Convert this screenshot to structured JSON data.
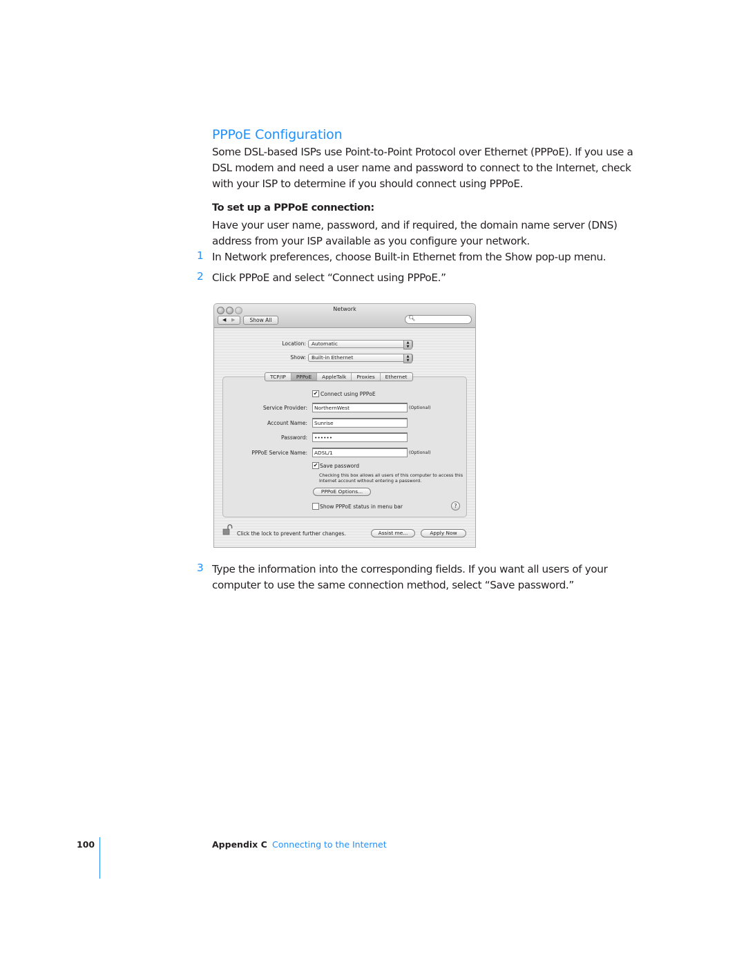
{
  "heading": "PPPoE Configuration",
  "intro": "Some DSL-based ISPs use Point-to-Point Protocol over Ethernet (PPPoE). If you use a DSL modem and need a user name and password to connect to the Internet, check with your ISP to determine if you should connect using PPPoE.",
  "subheading": "To set up a PPPoE connection:",
  "prereq": "Have your user name, password, and if required, the domain name server (DNS) address from your ISP available as you configure your network.",
  "steps": [
    {
      "num": "1",
      "text": "In Network preferences, choose Built-in Ethernet from the Show pop-up menu."
    },
    {
      "num": "2",
      "text": "Click PPPoE and select “Connect using PPPoE.”"
    },
    {
      "num": "3",
      "text": "Type the information into the corresponding fields. If you want all users of your computer to use the same connection method, select “Save password.”"
    }
  ],
  "window": {
    "title": "Network",
    "back_glyph": "◀",
    "forward_glyph": "▶",
    "show_all": "Show All",
    "search_glyph": "⚲",
    "location_label": "Location:",
    "location_value": "Automatic",
    "show_label": "Show:",
    "show_value": "Built-in Ethernet",
    "popup_arrows": "▲▼",
    "tabs": [
      {
        "label": "TCP/IP",
        "selected": false
      },
      {
        "label": "PPPoE",
        "selected": true
      },
      {
        "label": "AppleTalk",
        "selected": false
      },
      {
        "label": "Proxies",
        "selected": false
      },
      {
        "label": "Ethernet",
        "selected": false
      }
    ],
    "connect_checkbox": {
      "label": "Connect using PPPoE",
      "checked": true,
      "mark": "✔"
    },
    "fields": [
      {
        "label": "Service Provider:",
        "value": "NorthernWest",
        "optional": "(Optional)"
      },
      {
        "label": "Account Name:",
        "value": "Sunrise",
        "optional": ""
      },
      {
        "label": "Password:",
        "value": "••••••",
        "optional": ""
      },
      {
        "label": "PPPoE Service Name:",
        "value": "ADSL/1",
        "optional": "(Optional)"
      }
    ],
    "save_password": {
      "label": "Save password",
      "checked": true,
      "mark": "✔"
    },
    "save_note": "Checking this box allows all users of this computer to access this Internet account without entering a password.",
    "pppoe_options": "PPPoE Options...",
    "show_status": {
      "label": "Show PPPoE status in menu bar",
      "checked": false
    },
    "help": "?",
    "lock_text": "Click the lock to prevent further changes.",
    "assist": "Assist me...",
    "apply": "Apply Now"
  },
  "footer": {
    "page_number": "100",
    "appendix": "Appendix C",
    "chapter": "Connecting to the Internet"
  }
}
